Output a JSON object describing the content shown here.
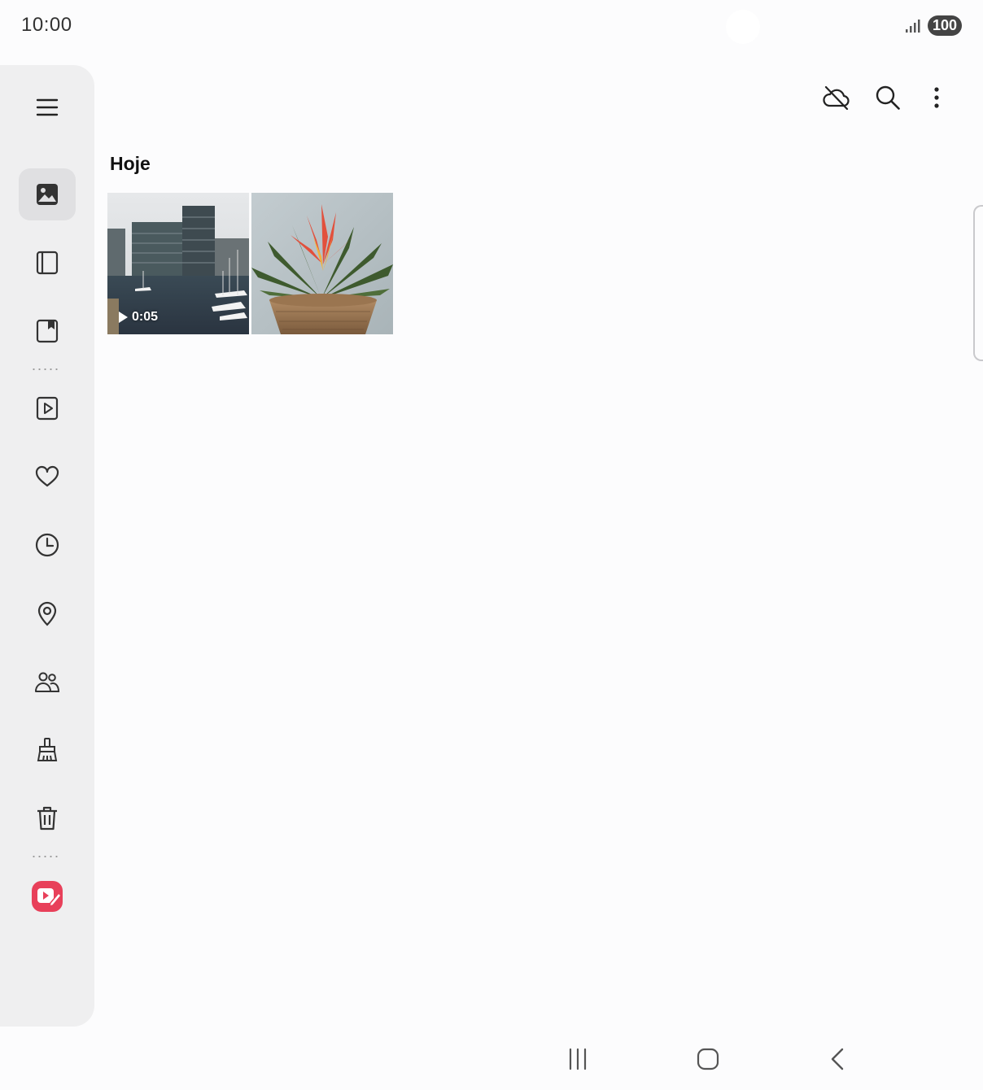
{
  "status_bar": {
    "time": "10:00",
    "battery": "100"
  },
  "sidebar": {
    "items": [
      {
        "name": "menu-icon"
      },
      {
        "name": "pictures-icon",
        "active": true
      },
      {
        "name": "albums-icon"
      },
      {
        "name": "stories-icon"
      },
      {
        "name": "videos-icon"
      },
      {
        "name": "favorites-icon"
      },
      {
        "name": "recent-icon"
      },
      {
        "name": "locations-icon"
      },
      {
        "name": "people-icon"
      },
      {
        "name": "cleanup-icon"
      },
      {
        "name": "trash-icon"
      },
      {
        "name": "video-editor-icon"
      }
    ]
  },
  "toolbar": {
    "cloud_icon": "cloud-off-icon",
    "search_icon": "search-icon",
    "more_icon": "more-vert-icon"
  },
  "main": {
    "section_title": "Hoje",
    "items": [
      {
        "type": "video",
        "duration": "0:05",
        "subject": "harbor-buildings"
      },
      {
        "type": "image",
        "subject": "potted-bromeliad"
      }
    ]
  },
  "colors": {
    "accent_video_editor": "#e8405a",
    "sidebar_bg": "#efeff0",
    "page_bg": "#fcfcfd"
  }
}
